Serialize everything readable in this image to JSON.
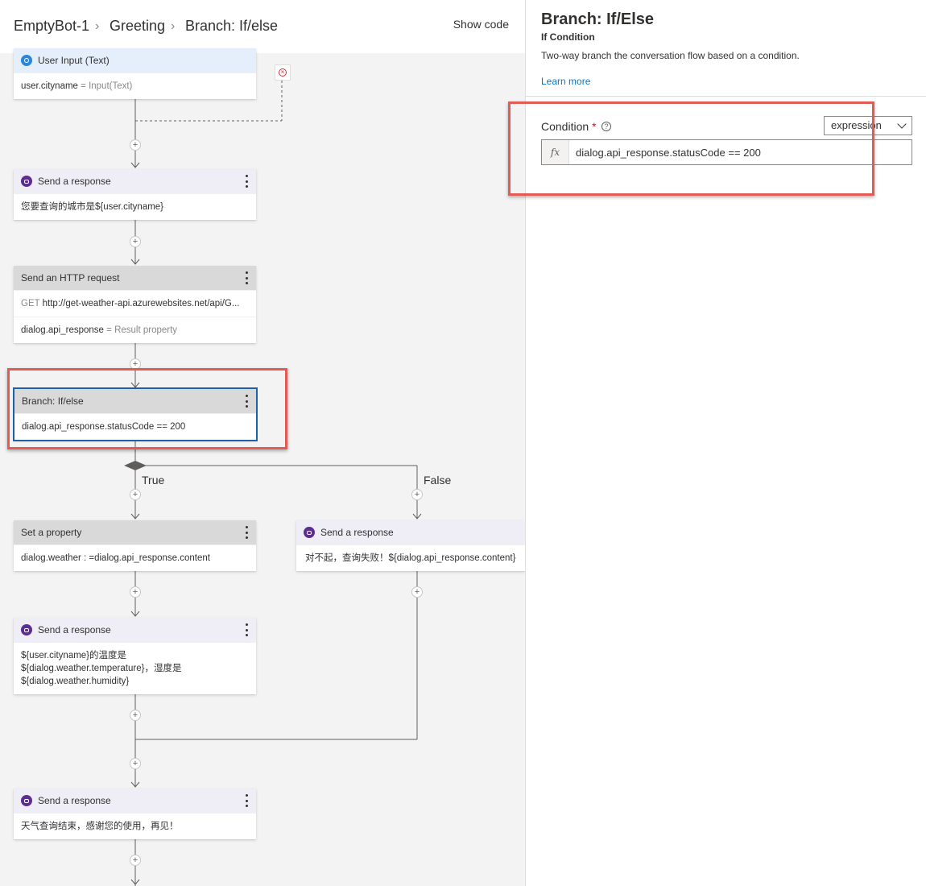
{
  "breadcrumb": {
    "items": [
      "EmptyBot-1",
      "Greeting",
      "Branch: If/else"
    ],
    "show_code": "Show code"
  },
  "nodes": {
    "user_input": {
      "title": "User Input (Text)",
      "prop": "user.cityname",
      "eq": " = ",
      "value": "Input(Text)"
    },
    "send1": {
      "title": "Send a response",
      "body": "您要查询的城市是${user.cityname}"
    },
    "http": {
      "title": "Send an HTTP request",
      "method": "GET",
      "url": "http://get-weather-api.azurewebsites.net/api/G...",
      "result_prop": "dialog.api_response",
      "eq": " = ",
      "result_label": "Result property"
    },
    "branch": {
      "title": "Branch: If/else",
      "condition": "dialog.api_response.statusCode == 200"
    },
    "set_prop": {
      "title": "Set a property",
      "body": "dialog.weather : =dialog.api_response.content"
    },
    "send_false": {
      "title": "Send a response",
      "body": "对不起，查询失败！${dialog.api_response.content}"
    },
    "send2": {
      "title": "Send a response",
      "line1": "${user.cityname}的温度是",
      "line2": "${dialog.weather.temperature}，湿度是",
      "line3": "${dialog.weather.humidity}"
    },
    "send3": {
      "title": "Send a response",
      "body": "天气查询结束，感谢您的使用，再见！"
    }
  },
  "branch_labels": {
    "true": "True",
    "false": "False"
  },
  "panel": {
    "title": "Branch: If/Else",
    "subtitle": "If Condition",
    "description": "Two-way branch the conversation flow based on a condition.",
    "learn_more": "Learn more",
    "condition_label": "Condition",
    "required_mark": "*",
    "help_glyph": "?",
    "type_select": "expression",
    "fx": "fx",
    "condition_value": "dialog.api_response.statusCode == 200"
  },
  "colors": {
    "accent": "#0078d4",
    "highlight": "#e25c55",
    "bot_icon": "#5c2e91",
    "user_icon": "#2b88d8",
    "selected_border": "#1f61a8"
  }
}
